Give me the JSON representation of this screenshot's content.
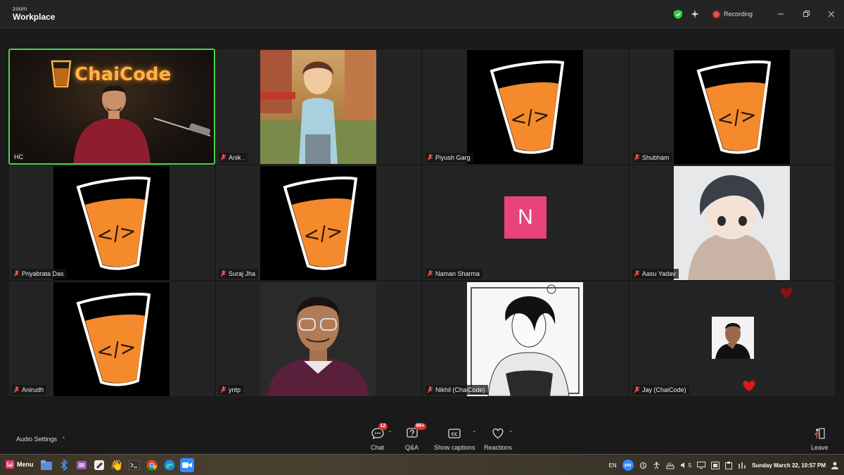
{
  "app": {
    "brand_small": "zoom",
    "brand_big": "Workplace",
    "recording_label": "Recording"
  },
  "participants": [
    {
      "name": "HC",
      "avatar": "video-feed",
      "active": true
    },
    {
      "name": "Anik .",
      "avatar": "anime-boy"
    },
    {
      "name": "Piyush Garg",
      "avatar": "chaicode-cup"
    },
    {
      "name": "Shubham",
      "avatar": "chaicode-cup"
    },
    {
      "name": "Priyabrata Das",
      "avatar": "chaicode-cup"
    },
    {
      "name": "Suraj Jha",
      "avatar": "chaicode-cup"
    },
    {
      "name": "Naman Sharma",
      "avatar": "initial",
      "initial": "N",
      "initial_color": "#e8437a"
    },
    {
      "name": "Aasu Yadav",
      "avatar": "anime-hoodie"
    },
    {
      "name": "Anirudh",
      "avatar": "chaicode-cup"
    },
    {
      "name": "yntp",
      "avatar": "photo-glasses"
    },
    {
      "name": "Nikhil (ChaiCode)",
      "avatar": "manga"
    },
    {
      "name": "Jay (ChaiCode)",
      "avatar": "small-photo"
    }
  ],
  "hc_logo_text": "ChaiCode",
  "cup_code": "</>",
  "toolbar": {
    "audio_settings": "Audio Settings",
    "chat_label": "Chat",
    "chat_badge": "12",
    "qa_label": "Q&A",
    "qa_badge": "99+",
    "captions_label": "Show captions",
    "reactions_label": "Reactions",
    "leave_label": "Leave"
  },
  "taskbar": {
    "menu_label": "Menu",
    "lang": "EN",
    "zm": "zm",
    "volume": "5",
    "datetime": "Sunday March 22, 10:57 PM"
  },
  "colors": {
    "active_border": "#49d34f",
    "badge": "#e02f2f",
    "cup_orange": "#f58a2c"
  }
}
